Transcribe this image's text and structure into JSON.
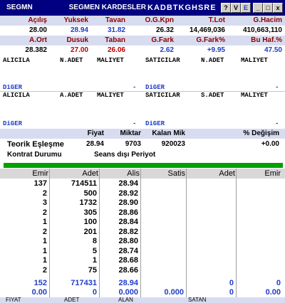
{
  "title": {
    "symbol": "SEGMN",
    "company": "SEGMEN KARDESLER",
    "code": "KADBTKGHSRE",
    "buttons": [
      "?",
      "V",
      "E",
      "_",
      "□",
      "x"
    ]
  },
  "stats": {
    "row1_headers": [
      "Açılış",
      "Yuksek",
      "Tavan",
      "O.G.Kpn",
      "T.Lot",
      "G.Hacim"
    ],
    "row1_values": [
      "28.00",
      "28.94",
      "31.82",
      "26.32",
      "14,469,036",
      "410,663,110"
    ],
    "row2_headers": [
      "A.Ort",
      "Dusuk",
      "Taban",
      "G.Fark",
      "G.Fark%",
      "Bu Haf.%"
    ],
    "row2_values": [
      "28.382",
      "27.00",
      "26.06",
      "2.62",
      "+9.95",
      "47.50"
    ]
  },
  "depth1": {
    "headers": [
      "ALICILA",
      "N.ADET",
      "MALIYET",
      "SATICILAR",
      "N.ADET",
      "MALIYET"
    ],
    "diger_left": "DiGER",
    "dash_left": "-",
    "diger_right": "DiGER",
    "dash_right": "-"
  },
  "depth2": {
    "headers": [
      "ALICILA",
      "A.ADET",
      "MALIYET",
      "SATICILAR",
      "S.ADET",
      "MALIYET"
    ],
    "diger_left": "DiGER",
    "dash_left": "-",
    "diger_right": "DiGER",
    "dash_right": "-"
  },
  "teorik": {
    "headers": [
      "Fiyat",
      "Miktar",
      "Kalan Mik",
      "% Değişim"
    ],
    "label": "Teorik Eşleşme",
    "values": [
      "28.94",
      "9703",
      "920023",
      "+0.00"
    ],
    "kontrat_label": "Kontrat Durumu",
    "kontrat_value": "Seans dışı Periyot"
  },
  "order_table": {
    "columns": [
      "Emir",
      "Adet",
      "Alis",
      "Satis",
      "Adet",
      "Emir"
    ],
    "rows": [
      [
        "137",
        "714511",
        "28.94"
      ],
      [
        "2",
        "500",
        "28.92"
      ],
      [
        "3",
        "1732",
        "28.90"
      ],
      [
        "2",
        "305",
        "28.86"
      ],
      [
        "1",
        "100",
        "28.84"
      ],
      [
        "2",
        "201",
        "28.82"
      ],
      [
        "1",
        "8",
        "28.80"
      ],
      [
        "1",
        "5",
        "28.74"
      ],
      [
        "1",
        "1",
        "28.68"
      ],
      [
        "2",
        "75",
        "28.66"
      ]
    ],
    "total_row": [
      "152",
      "717431",
      "28.94",
      "",
      "0",
      "0"
    ],
    "zero_row": [
      "0.00",
      "0",
      "0.000",
      "0.000",
      "0",
      "0.00"
    ]
  },
  "bottom_headers": [
    "FIYAT",
    "ADET",
    "ALAN",
    "SATAN"
  ],
  "colors": {
    "title_bg": "#000080",
    "header_bg": "#d8dcf0",
    "blue": "#1e3cc8",
    "red": "#c00000",
    "green": "#00a000"
  }
}
